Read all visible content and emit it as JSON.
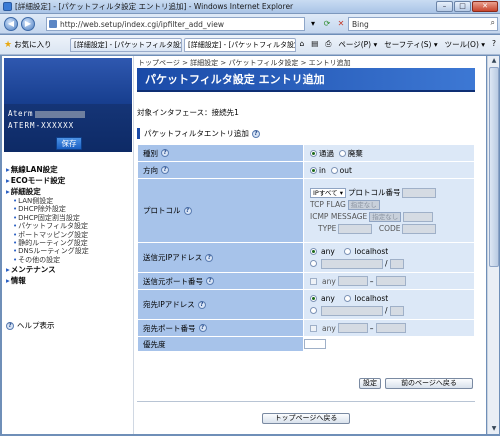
{
  "window": {
    "title": "[詳細設定] - [パケットフィルタ設定 エントリ追加] - Windows Internet Explorer",
    "url": "http://web.setup/index.cgi/ipfilter_add_view",
    "search_placeholder": "Bing"
  },
  "favbar": {
    "favorites_label": "お気に入り",
    "tabs": [
      "[詳細設定] - [パケットフィルタ設定 ...",
      "[詳細設定] - [パケットフィルタ設定 エ..."
    ],
    "commands": [
      "ページ(P) ▾",
      "セーフティ(S) ▾",
      "ツール(O) ▾"
    ]
  },
  "sidebar": {
    "model_label": "Aterm",
    "serial": "ATERM-XXXXXX",
    "save_label": "保存",
    "nav": [
      {
        "type": "main",
        "label": "無線LAN設定"
      },
      {
        "type": "main",
        "label": "ECOモード設定"
      },
      {
        "type": "main",
        "label": "詳細設定"
      },
      {
        "type": "sub",
        "label": "LAN側設定"
      },
      {
        "type": "sub",
        "label": "DHCP除外設定"
      },
      {
        "type": "sub",
        "label": "DHCP固定割当設定"
      },
      {
        "type": "sub",
        "label": "パケットフィルタ設定"
      },
      {
        "type": "sub",
        "label": "ポートマッピング設定"
      },
      {
        "type": "sub",
        "label": "静的ルーティング設定"
      },
      {
        "type": "sub",
        "label": "DNSルーティング設定"
      },
      {
        "type": "sub",
        "label": "その他の設定"
      },
      {
        "type": "main",
        "label": "メンテナンス"
      },
      {
        "type": "main",
        "label": "情報"
      }
    ],
    "help_label": "ヘルプ表示"
  },
  "main": {
    "breadcrumb": "トップページ > 詳細設定 > パケットフィルタ設定 > エントリ追加",
    "page_title": "パケットフィルタ設定 エントリ追加",
    "interface_text": "対象インタフェース：接続先1",
    "section_title": "パケットフィルタエントリ追加",
    "rows": {
      "type_label": "種別",
      "type_opt1": "通過",
      "type_opt2": "廃棄",
      "dir_label": "方向",
      "dir_opt1": "in",
      "dir_opt2": "out",
      "proto_label": "プロトコル",
      "proto_select": "IPすべて ▾",
      "proto_num_label": "プロトコル番号",
      "tcp_flag_label": "TCP FLAG",
      "tcp_flag_select": "指定なし",
      "icmp_msg_label": "ICMP MESSAGE",
      "icmp_msg_select": "指定なし",
      "type_sub_label": "TYPE",
      "code_sub_label": "CODE",
      "src_ip_label": "送信元IPアドレス",
      "any_label": "any",
      "localhost_label": "localhost",
      "slash": "/",
      "src_port_label": "送信元ポート番号",
      "dash": "–",
      "dst_ip_label": "宛先IPアドレス",
      "dst_port_label": "宛先ポート番号",
      "priority_label": "優先度"
    },
    "buttons": {
      "set": "設定",
      "back": "前のページへ戻る",
      "top": "トップページへ戻る"
    }
  }
}
